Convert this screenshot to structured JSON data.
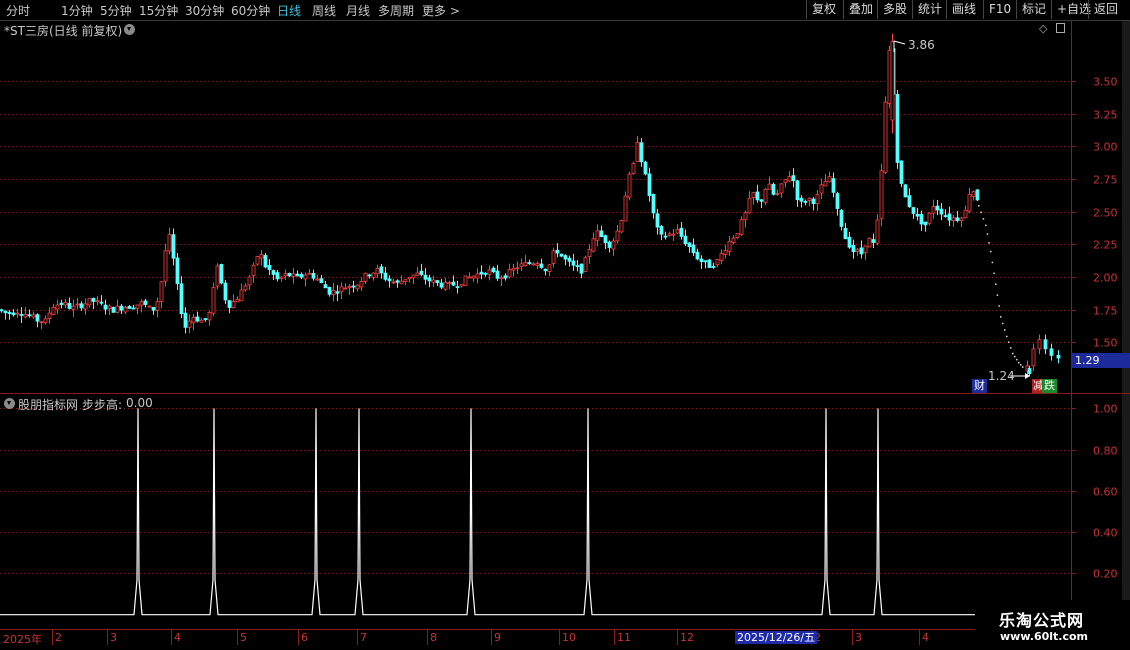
{
  "toolbar": {
    "timeframes": [
      "分时",
      "1分钟",
      "5分钟",
      "15分钟",
      "30分钟",
      "60分钟",
      "日线",
      "周线",
      "月线",
      "多周期",
      "更多"
    ],
    "more_arrow": ">",
    "active": "日线",
    "right_buttons": [
      "复权",
      "叠加",
      "多股",
      "统计",
      "画线",
      "F10",
      "标记",
      "+自选",
      "返回"
    ]
  },
  "main_panel": {
    "title": "*ST三房(日线 前复权)",
    "peak_label": "3.86",
    "low_label": "1.24",
    "current_price": "1.29",
    "badge_cai": "财",
    "badge_die": "跌",
    "badge_die_prefix": "减"
  },
  "indicator_panel": {
    "title": "股朋指标网",
    "indicator_name": "步步高:",
    "indicator_value": "0.00"
  },
  "time_axis": {
    "labels": [
      "2025年",
      "2",
      "3",
      "4",
      "5",
      "6",
      "7",
      "8",
      "9",
      "10",
      "11",
      "12",
      "2",
      "3",
      "4"
    ],
    "highlight": "2025/12/26/五"
  },
  "watermark": {
    "line1": "乐淘公式网",
    "line2": "www.60lt.com"
  },
  "colors": {
    "up": "#ff4040",
    "down": "#54ffff",
    "grid": "#8b1a1a",
    "active_tab": "#3fbfd8",
    "axis_text": "#c83232"
  },
  "chart_data": [
    {
      "type": "candlestick",
      "title": "*ST三房(日线 前复权)",
      "y_ticks": [
        1.5,
        1.75,
        2.0,
        2.25,
        2.5,
        2.75,
        3.0,
        3.25,
        3.5
      ],
      "ylim": [
        1.12,
        3.95
      ],
      "grid": true,
      "annotations": [
        {
          "label": "3.86",
          "value": 3.86
        },
        {
          "label": "1.24",
          "value": 1.24
        }
      ],
      "close_path": [
        [
          0,
          1.75
        ],
        [
          10,
          1.72
        ],
        [
          20,
          1.74
        ],
        [
          30,
          1.71
        ],
        [
          40,
          1.67
        ],
        [
          48,
          1.66
        ],
        [
          55,
          1.78
        ],
        [
          65,
          1.8
        ],
        [
          75,
          1.76
        ],
        [
          85,
          1.79
        ],
        [
          95,
          1.82
        ],
        [
          105,
          1.78
        ],
        [
          115,
          1.75
        ],
        [
          125,
          1.77
        ],
        [
          135,
          1.78
        ],
        [
          145,
          1.8
        ],
        [
          155,
          1.74
        ],
        [
          162,
          1.85
        ],
        [
          168,
          2.2
        ],
        [
          172,
          2.3
        ],
        [
          178,
          2.05
        ],
        [
          182,
          1.8
        ],
        [
          188,
          1.62
        ],
        [
          195,
          1.7
        ],
        [
          200,
          1.68
        ],
        [
          206,
          1.66
        ],
        [
          212,
          1.72
        ],
        [
          216,
          1.9
        ],
        [
          220,
          2.1
        ],
        [
          224,
          1.95
        ],
        [
          230,
          1.78
        ],
        [
          238,
          1.82
        ],
        [
          245,
          1.9
        ],
        [
          252,
          2.0
        ],
        [
          258,
          2.1
        ],
        [
          262,
          2.22
        ],
        [
          266,
          2.1
        ],
        [
          272,
          2.05
        ],
        [
          280,
          1.98
        ],
        [
          290,
          2.02
        ],
        [
          300,
          1.99
        ],
        [
          310,
          2.03
        ],
        [
          318,
          2.0
        ],
        [
          325,
          1.94
        ],
        [
          333,
          1.88
        ],
        [
          340,
          1.9
        ],
        [
          350,
          1.93
        ],
        [
          360,
          1.95
        ],
        [
          370,
          2.02
        ],
        [
          380,
          2.05
        ],
        [
          390,
          1.98
        ],
        [
          400,
          1.95
        ],
        [
          410,
          2.0
        ],
        [
          420,
          2.02
        ],
        [
          430,
          1.98
        ],
        [
          440,
          1.95
        ],
        [
          450,
          1.93
        ],
        [
          460,
          1.95
        ],
        [
          470,
          1.99
        ],
        [
          480,
          2.02
        ],
        [
          490,
          2.05
        ],
        [
          500,
          2.0
        ],
        [
          510,
          2.02
        ],
        [
          520,
          2.08
        ],
        [
          530,
          2.1
        ],
        [
          540,
          2.12
        ],
        [
          550,
          2.05
        ],
        [
          558,
          2.22
        ],
        [
          565,
          2.15
        ],
        [
          575,
          2.08
        ],
        [
          585,
          2.05
        ],
        [
          592,
          2.22
        ],
        [
          598,
          2.35
        ],
        [
          605,
          2.3
        ],
        [
          612,
          2.25
        ],
        [
          618,
          2.3
        ],
        [
          624,
          2.45
        ],
        [
          630,
          2.72
        ],
        [
          636,
          2.85
        ],
        [
          640,
          3.05
        ],
        [
          644,
          2.9
        ],
        [
          650,
          2.7
        ],
        [
          656,
          2.48
        ],
        [
          662,
          2.3
        ],
        [
          670,
          2.32
        ],
        [
          680,
          2.35
        ],
        [
          690,
          2.25
        ],
        [
          700,
          2.15
        ],
        [
          710,
          2.08
        ],
        [
          720,
          2.12
        ],
        [
          730,
          2.25
        ],
        [
          740,
          2.35
        ],
        [
          748,
          2.48
        ],
        [
          755,
          2.65
        ],
        [
          762,
          2.55
        ],
        [
          770,
          2.72
        ],
        [
          778,
          2.6
        ],
        [
          786,
          2.72
        ],
        [
          794,
          2.8
        ],
        [
          802,
          2.55
        ],
        [
          810,
          2.6
        ],
        [
          818,
          2.58
        ],
        [
          826,
          2.72
        ],
        [
          833,
          2.75
        ],
        [
          840,
          2.5
        ],
        [
          848,
          2.3
        ],
        [
          856,
          2.2
        ],
        [
          864,
          2.18
        ],
        [
          870,
          2.3
        ],
        [
          876,
          2.25
        ],
        [
          882,
          2.5
        ],
        [
          886,
          3.1
        ],
        [
          890,
          3.55
        ],
        [
          893,
          3.82
        ],
        [
          896,
          3.4
        ],
        [
          900,
          2.9
        ],
        [
          905,
          2.65
        ],
        [
          912,
          2.55
        ],
        [
          920,
          2.45
        ],
        [
          928,
          2.4
        ],
        [
          936,
          2.55
        ],
        [
          944,
          2.5
        ],
        [
          952,
          2.45
        ],
        [
          960,
          2.45
        ],
        [
          968,
          2.5
        ],
        [
          974,
          2.72
        ],
        [
          978,
          2.6
        ]
      ],
      "dotted_path": [
        [
          978,
          2.55
        ],
        [
          985,
          2.4
        ],
        [
          990,
          2.2
        ],
        [
          995,
          1.95
        ],
        [
          1000,
          1.7
        ],
        [
          1006,
          1.55
        ],
        [
          1012,
          1.42
        ],
        [
          1018,
          1.35
        ],
        [
          1024,
          1.3
        ]
      ],
      "tail_path": [
        [
          1024,
          1.28
        ],
        [
          1030,
          1.32
        ],
        [
          1036,
          1.45
        ],
        [
          1042,
          1.52
        ],
        [
          1048,
          1.45
        ],
        [
          1055,
          1.4
        ],
        [
          1062,
          1.38
        ]
      ]
    },
    {
      "type": "line",
      "name": "步步高",
      "y_ticks": [
        0.2,
        0.4,
        0.6,
        0.8,
        1.0
      ],
      "ylim": [
        -0.05,
        1.05
      ],
      "grid": true,
      "spikes_x": [
        138,
        214,
        316,
        359,
        471,
        588,
        826,
        878
      ],
      "values": "0/1 spikes"
    }
  ]
}
